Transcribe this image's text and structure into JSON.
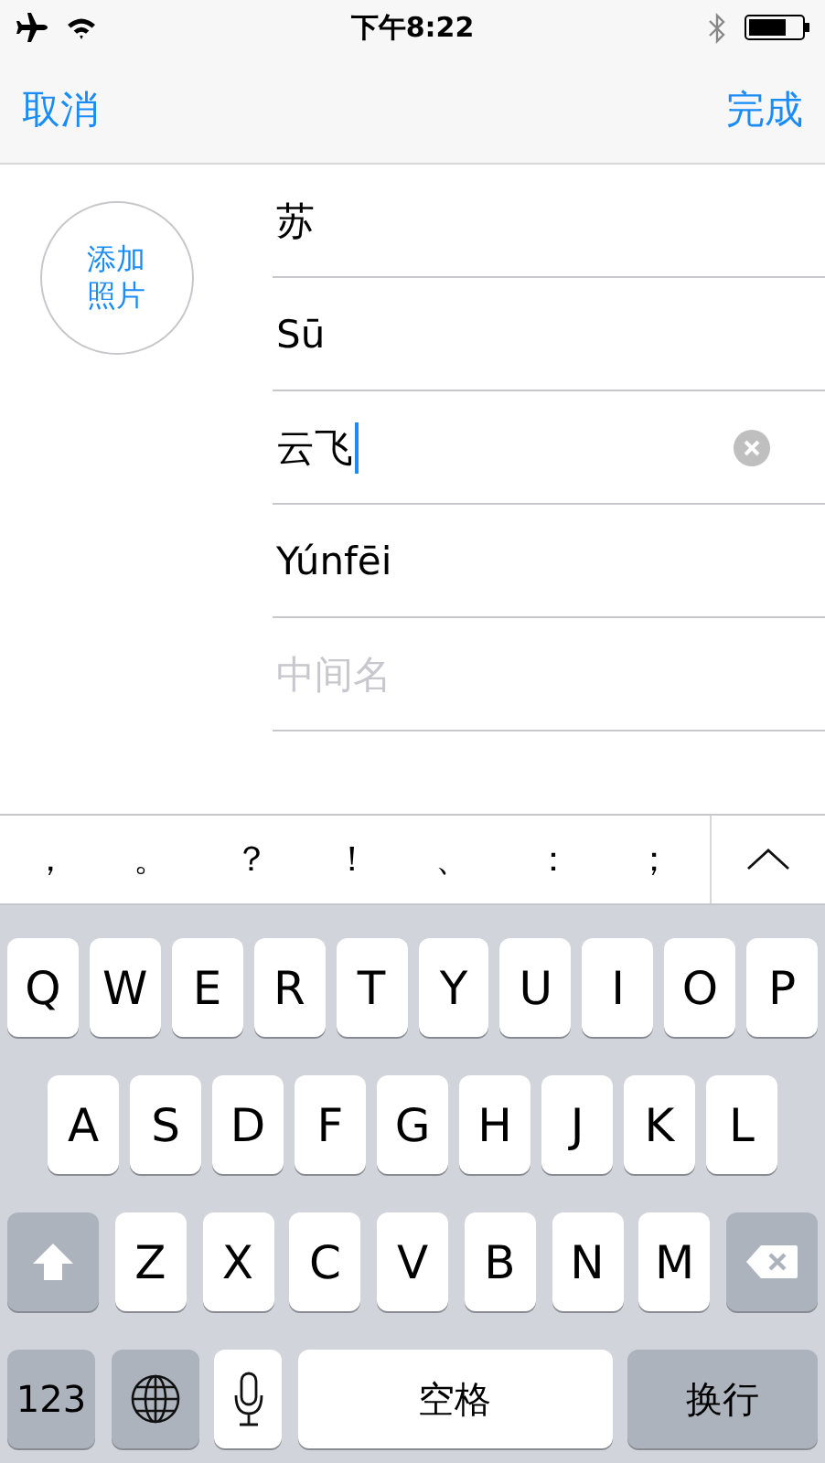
{
  "status_bar": {
    "time": "下午8:22"
  },
  "nav": {
    "cancel": "取消",
    "done": "完成"
  },
  "photo": {
    "label": "添加照片"
  },
  "fields": [
    {
      "value": "苏",
      "focused": false
    },
    {
      "value": "Sū",
      "focused": false
    },
    {
      "value": "云飞",
      "focused": true
    },
    {
      "value": "Yúnfēi",
      "focused": false
    },
    {
      "placeholder": "中间名",
      "focused": false
    }
  ],
  "candidates": [
    "，",
    "。",
    "？",
    "！",
    "、",
    "：",
    "；"
  ],
  "keyboard": [
    [
      {
        "kind": "letter",
        "label": "Q"
      },
      {
        "kind": "letter",
        "label": "W"
      },
      {
        "kind": "letter",
        "label": "E"
      },
      {
        "kind": "letter",
        "label": "R"
      },
      {
        "kind": "letter",
        "label": "T"
      },
      {
        "kind": "letter",
        "label": "Y"
      },
      {
        "kind": "letter",
        "label": "U"
      },
      {
        "kind": "letter",
        "label": "I"
      },
      {
        "kind": "letter",
        "label": "O"
      },
      {
        "kind": "letter",
        "label": "P"
      }
    ],
    [
      {
        "kind": "letter",
        "label": "A"
      },
      {
        "kind": "letter",
        "label": "S"
      },
      {
        "kind": "letter",
        "label": "D"
      },
      {
        "kind": "letter",
        "label": "F"
      },
      {
        "kind": "letter",
        "label": "G"
      },
      {
        "kind": "letter",
        "label": "H"
      },
      {
        "kind": "letter",
        "label": "J"
      },
      {
        "kind": "letter",
        "label": "K"
      },
      {
        "kind": "letter",
        "label": "L"
      }
    ],
    [
      {
        "kind": "shift"
      },
      {
        "kind": "letter",
        "label": "Z"
      },
      {
        "kind": "letter",
        "label": "X"
      },
      {
        "kind": "letter",
        "label": "C"
      },
      {
        "kind": "letter",
        "label": "V"
      },
      {
        "kind": "letter",
        "label": "B"
      },
      {
        "kind": "letter",
        "label": "N"
      },
      {
        "kind": "letter",
        "label": "M"
      },
      {
        "kind": "delete"
      }
    ],
    [
      {
        "kind": "function",
        "label": "123"
      },
      {
        "kind": "globe"
      },
      {
        "kind": "mic"
      },
      {
        "kind": "space",
        "label": "空格"
      },
      {
        "kind": "return",
        "label": "换行"
      }
    ]
  ]
}
